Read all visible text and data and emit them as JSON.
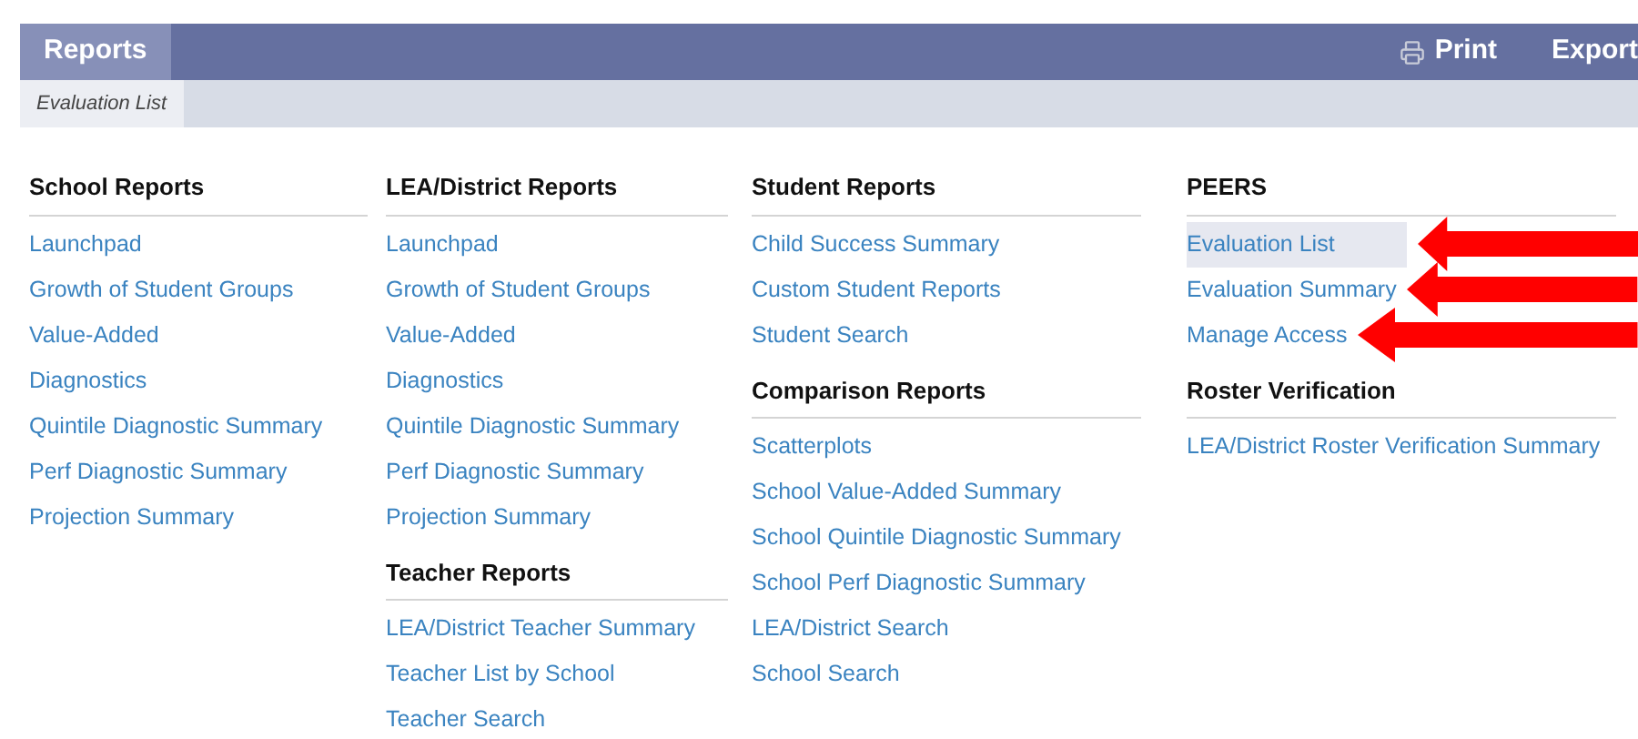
{
  "header": {
    "tab": "Reports",
    "actions": [
      {
        "kind": "print",
        "label": "Print"
      },
      {
        "kind": "plain",
        "label": "Export"
      }
    ]
  },
  "breadcrumb": "Evaluation List",
  "columns": [
    {
      "sections": [
        {
          "title": "School Reports",
          "items": [
            {
              "label": "Launchpad",
              "selected": false
            },
            {
              "label": "Growth of Student Groups",
              "selected": false
            },
            {
              "label": "Value-Added",
              "selected": false
            },
            {
              "label": "Diagnostics",
              "selected": false
            },
            {
              "label": "Quintile Diagnostic Summary",
              "selected": false
            },
            {
              "label": "Perf Diagnostic Summary",
              "selected": false
            },
            {
              "label": "Projection Summary",
              "selected": false
            }
          ]
        }
      ]
    },
    {
      "sections": [
        {
          "title": "LEA/District Reports",
          "items": [
            {
              "label": "Launchpad",
              "selected": false
            },
            {
              "label": "Growth of Student Groups",
              "selected": false
            },
            {
              "label": "Value-Added",
              "selected": false
            },
            {
              "label": "Diagnostics",
              "selected": false
            },
            {
              "label": "Quintile Diagnostic Summary",
              "selected": false
            },
            {
              "label": "Perf Diagnostic Summary",
              "selected": false
            },
            {
              "label": "Projection Summary",
              "selected": false
            }
          ]
        },
        {
          "title": "Teacher Reports",
          "items": [
            {
              "label": "LEA/District Teacher Summary",
              "selected": false
            },
            {
              "label": "Teacher List by School",
              "selected": false
            },
            {
              "label": "Teacher Search",
              "selected": false
            }
          ]
        }
      ]
    },
    {
      "sections": [
        {
          "title": "Student Reports",
          "items": [
            {
              "label": "Child Success Summary",
              "selected": false
            },
            {
              "label": "Custom Student Reports",
              "selected": false
            },
            {
              "label": "Student Search",
              "selected": false
            }
          ]
        },
        {
          "title": "Comparison Reports",
          "items": [
            {
              "label": "Scatterplots",
              "selected": false
            },
            {
              "label": "School Value-Added Summary",
              "selected": false
            },
            {
              "label": "School Quintile Diagnostic Summary",
              "selected": false
            },
            {
              "label": "School Perf Diagnostic Summary",
              "selected": false
            },
            {
              "label": "LEA/District Search",
              "selected": false
            },
            {
              "label": "School Search",
              "selected": false
            }
          ]
        }
      ]
    },
    {
      "sections": [
        {
          "title": "PEERS",
          "items": [
            {
              "label": "Evaluation List",
              "selected": true,
              "arrow": true
            },
            {
              "label": "Evaluation Summary",
              "selected": false,
              "arrow": true
            },
            {
              "label": "Manage Access",
              "selected": false,
              "arrow": true
            }
          ]
        },
        {
          "title": "Roster Verification",
          "items": [
            {
              "label": "LEA/District Roster Verification Summary",
              "selected": false
            }
          ]
        }
      ]
    }
  ]
}
